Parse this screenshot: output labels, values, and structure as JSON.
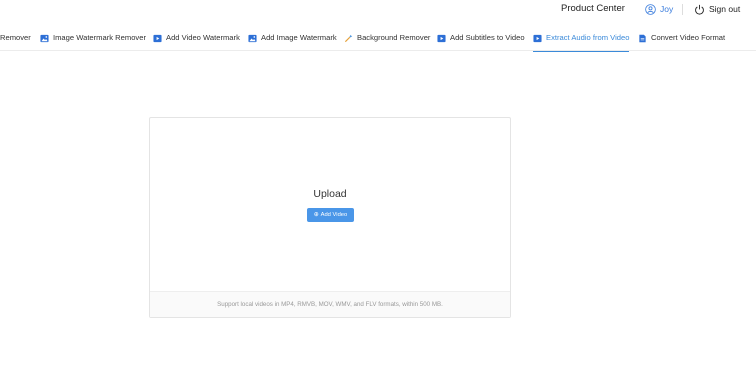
{
  "header": {
    "product_center": "Product Center",
    "user_name": "Joy",
    "sign_out": "Sign out",
    "user_color": "#3b7ddd"
  },
  "tabs": [
    {
      "label": "Remover",
      "icon": "none",
      "active": false
    },
    {
      "label": "Image Watermark Remover",
      "icon": "image-icon",
      "active": false
    },
    {
      "label": "Add Video Watermark",
      "icon": "video-icon",
      "active": false
    },
    {
      "label": "Add Image Watermark",
      "icon": "image-icon",
      "active": false
    },
    {
      "label": "Background Remover",
      "icon": "magic-wand-icon",
      "active": false
    },
    {
      "label": "Add Subtitles to Video",
      "icon": "video-icon",
      "active": false
    },
    {
      "label": "Extract Audio from Video",
      "icon": "video-icon",
      "active": true
    },
    {
      "label": "Convert Video Format",
      "icon": "document-icon",
      "active": false
    }
  ],
  "upload": {
    "title": "Upload",
    "button_label": "Add Video",
    "button_icon": "plus-icon",
    "footer_text": "Support local videos in MP4, RMVB, MOV, WMV, and FLV formats,  within 500 MB."
  },
  "colors": {
    "accent": "#3b8ad9",
    "button": "#4a96e8"
  }
}
